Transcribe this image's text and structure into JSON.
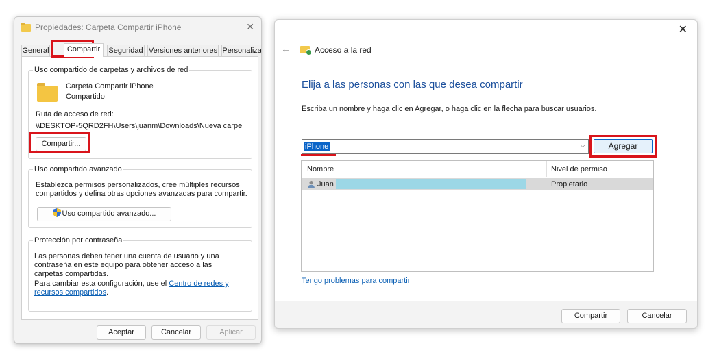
{
  "props_dialog": {
    "title": "Propiedades: Carpeta Compartir iPhone",
    "tabs": [
      "General",
      "Compartir",
      "Seguridad",
      "Versiones anteriores",
      "Personalizar"
    ],
    "network_group": {
      "title": "Uso compartido de carpetas y archivos de red",
      "folder_name": "Carpeta Compartir iPhone",
      "folder_status": "Compartido",
      "path_label": "Ruta de acceso de red:",
      "path_value": "\\\\DESKTOP-5QRD2FH\\Users\\juanm\\Downloads\\Nueva carpe",
      "share_button": "Compartir..."
    },
    "advanced_group": {
      "title": "Uso compartido avanzado",
      "description": "Establezca permisos personalizados, cree múltiples recursos compartidos y defina otras opciones avanzadas para compartir.",
      "button": "Uso compartido avanzado..."
    },
    "password_group": {
      "title": "Protección por contraseña",
      "description": "Las personas deben tener una cuenta de usuario y una contraseña en este equipo para obtener acceso a las carpetas compartidas.",
      "change_prefix": "Para cambiar esta configuración, use el ",
      "link_text": "Centro de redes y recursos compartidos",
      "suffix": "."
    },
    "buttons": {
      "ok": "Aceptar",
      "cancel": "Cancelar",
      "apply": "Aplicar"
    }
  },
  "share_dialog": {
    "header_title": "Acceso a la red",
    "heading": "Elija a las personas con las que desea compartir",
    "instruction": "Escriba un nombre y haga clic en Agregar, o haga clic en la flecha para buscar usuarios.",
    "input_value": "iPhone",
    "add_button": "Agregar",
    "columns": {
      "name": "Nombre",
      "permission": "Nivel de permiso"
    },
    "rows": [
      {
        "name": "Juan",
        "permission": "Propietario"
      }
    ],
    "help_link": "Tengo problemas para compartir",
    "buttons": {
      "share": "Compartir",
      "cancel": "Cancelar"
    }
  },
  "colors": {
    "highlight_box": "#d9141b",
    "link": "#0a5fb4",
    "heading": "#1b4f9c"
  }
}
